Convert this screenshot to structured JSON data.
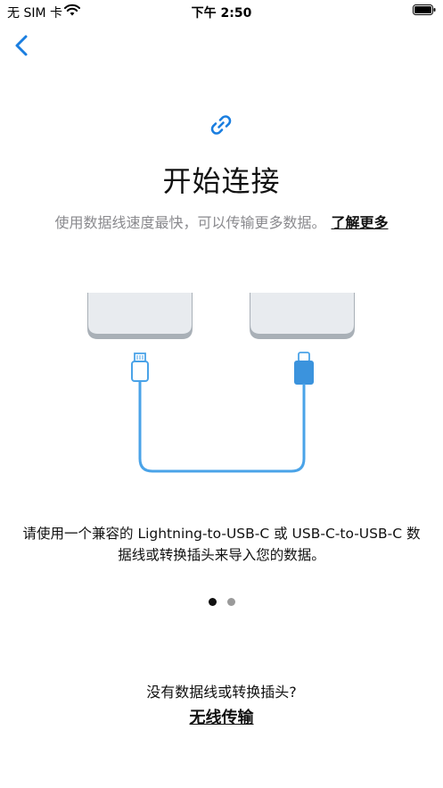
{
  "status_bar": {
    "carrier": "无 SIM 卡",
    "time": "下午 2:50",
    "icons": [
      "wifi-icon",
      "battery-icon"
    ]
  },
  "nav": {
    "back_icon": "chevron-left-icon"
  },
  "header": {
    "icon": "link-icon",
    "title": "开始连接",
    "subtitle": "使用数据线速度最快，可以传输更多数据。",
    "learn_more": "了解更多"
  },
  "illustration": {
    "icons": [
      "phone-left",
      "phone-right",
      "lightning-connector-icon",
      "usb-c-connector-icon",
      "cable"
    ],
    "colors": {
      "cable": "#4aa3e8",
      "connector_fill": "#3b93dd",
      "phone_body": "#e8ebef",
      "phone_edge": "#a9b0b7"
    }
  },
  "description": "请使用一个兼容的 Lightning-to-USB-C 或 USB-C-to-USB-C 数据线或转换插头来导入您的数据。",
  "pagination": {
    "pages": 2,
    "current": 1
  },
  "footer": {
    "question": "没有数据线或转换插头?",
    "wireless_label": "无线传输"
  },
  "colors": {
    "accent": "#1a7ee0",
    "text": "#111111",
    "secondary_text": "#8a8a8e"
  }
}
